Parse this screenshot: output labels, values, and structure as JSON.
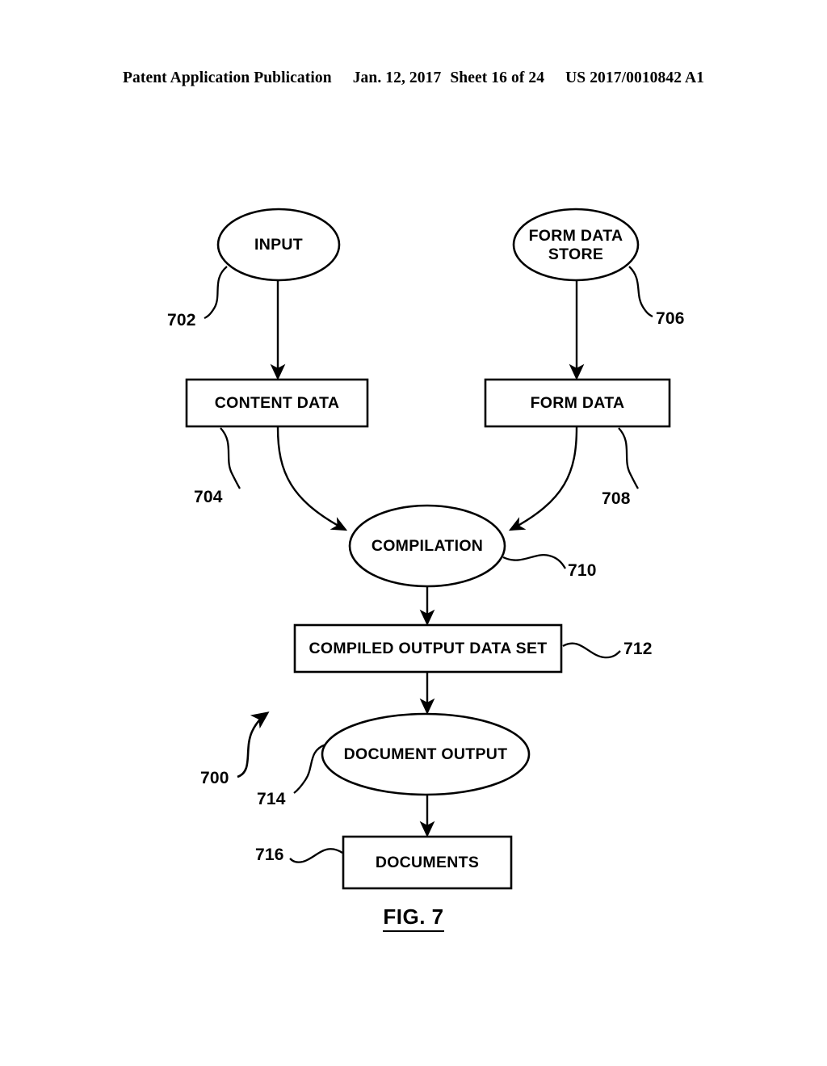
{
  "header": {
    "publication": "Patent Application Publication",
    "date": "Jan. 12, 2017",
    "sheet": "Sheet 16 of 24",
    "patent_number": "US 2017/0010842 A1"
  },
  "figure": {
    "caption": "FIG. 7",
    "overall_ref": "700",
    "nodes": [
      {
        "id": "input",
        "label": "INPUT",
        "shape": "ellipse",
        "ref": "702"
      },
      {
        "id": "form_store",
        "label": "FORM DATA\nSTORE",
        "shape": "ellipse",
        "ref": "706"
      },
      {
        "id": "content_data",
        "label": "CONTENT DATA",
        "shape": "rect",
        "ref": "704"
      },
      {
        "id": "form_data",
        "label": "FORM DATA",
        "shape": "rect",
        "ref": "708"
      },
      {
        "id": "compilation",
        "label": "COMPILATION",
        "shape": "ellipse",
        "ref": "710"
      },
      {
        "id": "output_set",
        "label": "COMPILED OUTPUT DATA SET",
        "shape": "rect",
        "ref": "712"
      },
      {
        "id": "doc_output",
        "label": "DOCUMENT OUTPUT",
        "shape": "ellipse",
        "ref": "714"
      },
      {
        "id": "documents",
        "label": "DOCUMENTS",
        "shape": "rect",
        "ref": "716"
      }
    ],
    "edges": [
      {
        "from": "input",
        "to": "content_data",
        "style": "straight"
      },
      {
        "from": "form_store",
        "to": "form_data",
        "style": "straight"
      },
      {
        "from": "content_data",
        "to": "compilation",
        "style": "curved"
      },
      {
        "from": "form_data",
        "to": "compilation",
        "style": "curved"
      },
      {
        "from": "compilation",
        "to": "output_set",
        "style": "straight"
      },
      {
        "from": "output_set",
        "to": "doc_output",
        "style": "straight"
      },
      {
        "from": "doc_output",
        "to": "documents",
        "style": "straight"
      }
    ]
  },
  "colors": {
    "ink": "#000000",
    "paper": "#ffffff"
  }
}
